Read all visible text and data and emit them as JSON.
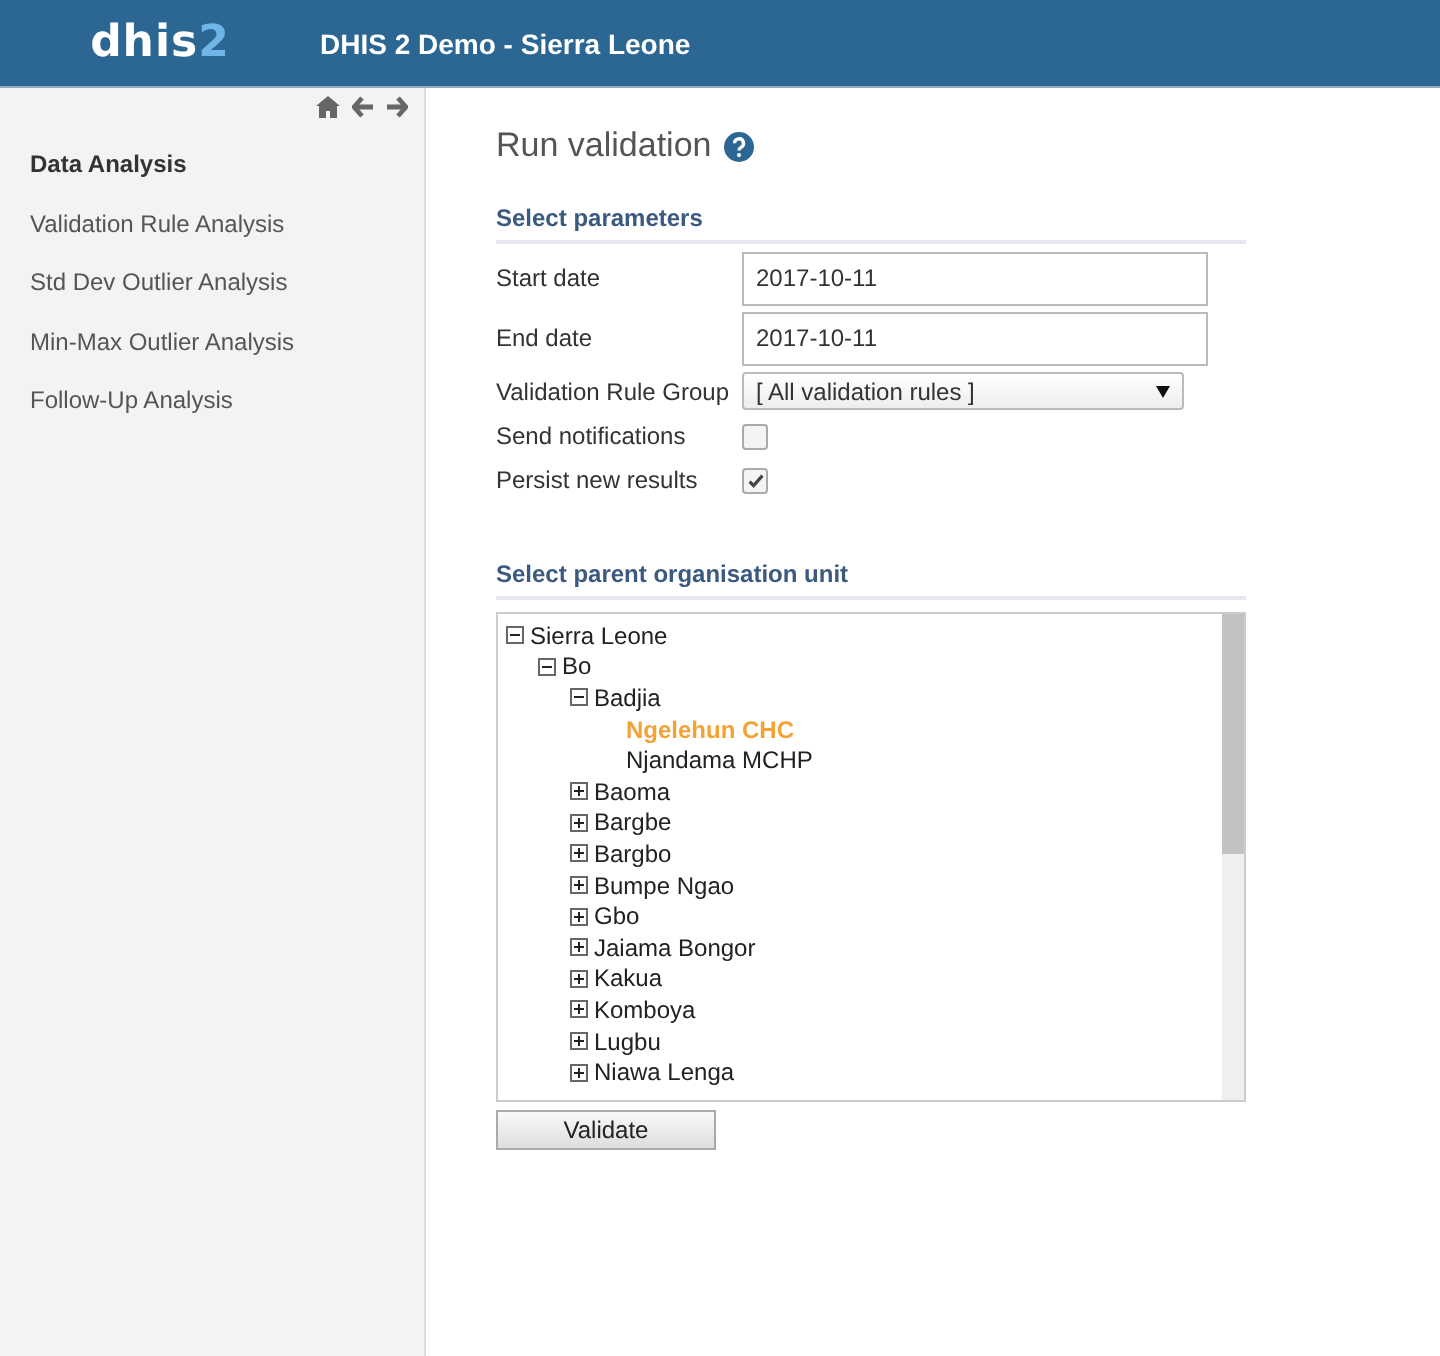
{
  "header": {
    "logo_text": "dhis",
    "logo_digit": "2",
    "title": "DHIS 2 Demo - Sierra Leone"
  },
  "sidebar": {
    "items": [
      {
        "label": "Data Analysis",
        "selected": true
      },
      {
        "label": "Validation Rule Analysis",
        "selected": false
      },
      {
        "label": "Std Dev Outlier Analysis",
        "selected": false
      },
      {
        "label": "Min-Max Outlier Analysis",
        "selected": false
      },
      {
        "label": "Follow-Up Analysis",
        "selected": false
      }
    ]
  },
  "page_title": "Run validation",
  "parameters": {
    "heading": "Select parameters",
    "fields": [
      {
        "kind": "text",
        "label": "Start date",
        "value": "2017-10-11"
      },
      {
        "kind": "text",
        "label": "End date",
        "value": "2017-10-11"
      },
      {
        "kind": "select",
        "label": "Validation Rule Group",
        "value": "[ All validation rules ]"
      },
      {
        "kind": "checkbox",
        "label": "Send notifications",
        "checked": false
      },
      {
        "kind": "checkbox",
        "label": "Persist new results",
        "checked": true
      }
    ]
  },
  "org_units": {
    "heading": "Select parent organisation unit",
    "tree": [
      {
        "label": "Sierra Leone",
        "expanded": true,
        "selected": false,
        "children": [
          {
            "label": "Bo",
            "expanded": true,
            "selected": false,
            "children": [
              {
                "label": "Badjia",
                "expanded": true,
                "selected": false,
                "children": [
                  {
                    "label": "Ngelehun CHC",
                    "selected": true
                  },
                  {
                    "label": "Njandama MCHP",
                    "selected": false
                  }
                ]
              },
              {
                "label": "Baoma",
                "expanded": false,
                "selected": false
              },
              {
                "label": "Bargbe",
                "expanded": false,
                "selected": false
              },
              {
                "label": "Bargbo",
                "expanded": false,
                "selected": false
              },
              {
                "label": "Bumpe Ngao",
                "expanded": false,
                "selected": false
              },
              {
                "label": "Gbo",
                "expanded": false,
                "selected": false
              },
              {
                "label": "Jaiama Bongor",
                "expanded": false,
                "selected": false
              },
              {
                "label": "Kakua",
                "expanded": false,
                "selected": false
              },
              {
                "label": "Komboya",
                "expanded": false,
                "selected": false
              },
              {
                "label": "Lugbu",
                "expanded": false,
                "selected": false
              },
              {
                "label": "Niawa Lenga",
                "expanded": false,
                "selected": false
              }
            ]
          }
        ]
      }
    ]
  },
  "validate_button": "Validate"
}
